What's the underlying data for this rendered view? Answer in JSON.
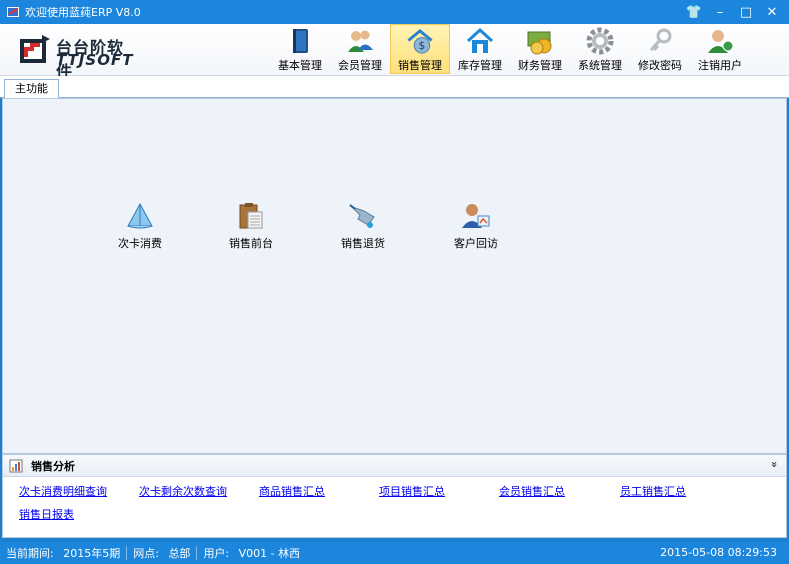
{
  "window": {
    "title": "欢迎使用蓝莼ERP V8.0",
    "buttons": [
      "👕",
      "–",
      "□",
      "✕"
    ]
  },
  "logo": {
    "line1": "台台阶软件",
    "line2": "TTJSOFT"
  },
  "toolbar": {
    "items": [
      {
        "label": "基本管理",
        "icon": "book-icon"
      },
      {
        "label": "会员管理",
        "icon": "users-icon"
      },
      {
        "label": "销售管理",
        "icon": "money-house-icon",
        "active": true
      },
      {
        "label": "库存管理",
        "icon": "house-icon"
      },
      {
        "label": "财务管理",
        "icon": "coins-icon"
      },
      {
        "label": "系统管理",
        "icon": "gear-icon"
      },
      {
        "label": "修改密码",
        "icon": "key-icon"
      },
      {
        "label": "注销用户",
        "icon": "user-logout-icon"
      }
    ]
  },
  "tabs": [
    {
      "label": "主功能"
    }
  ],
  "functions": [
    {
      "label": "次卡消费",
      "icon": "pyramid-icon"
    },
    {
      "label": "销售前台",
      "icon": "clipboard-icon"
    },
    {
      "label": "销售退货",
      "icon": "return-cart-icon"
    },
    {
      "label": "客户回访",
      "icon": "customer-visit-icon"
    }
  ],
  "analysis": {
    "title": "销售分析",
    "collapse_glyph": "»",
    "links": [
      "次卡消费明细查询",
      "次卡剩余次数查询",
      "商品销售汇总",
      "项目销售汇总",
      "会员销售汇总",
      "员工销售汇总",
      "销售日报表"
    ]
  },
  "status": {
    "period_label": "当前期间:",
    "period_value": "2015年5期",
    "site_label": "网点:",
    "site_value": "总部",
    "user_label": "用户:",
    "user_value": "V001 - 林西",
    "datetime": "2015-05-08 08:29:53"
  }
}
